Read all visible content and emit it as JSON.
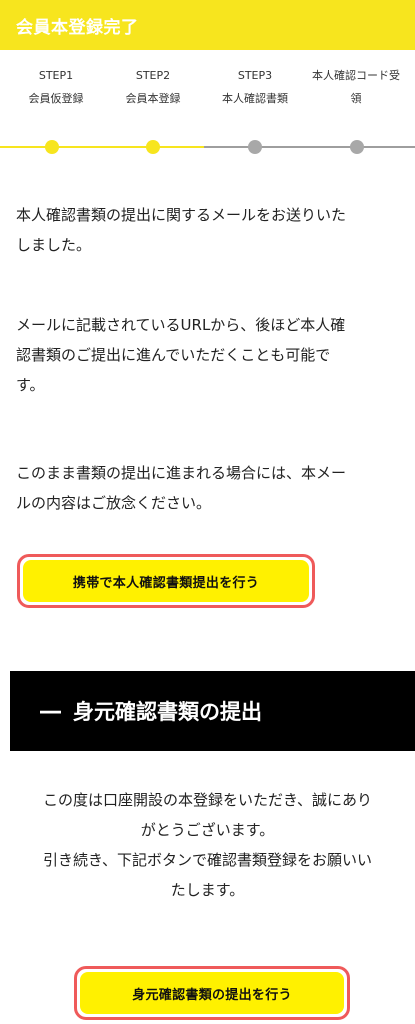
{
  "header": {
    "title": "会員本登録完了"
  },
  "steps": [
    {
      "label": "STEP1",
      "sub": "会員仮登録"
    },
    {
      "label": "STEP2",
      "sub": "会員本登録"
    },
    {
      "label": "STEP3",
      "sub": "本人確認書類"
    },
    {
      "label": "本人確認コード受",
      "sub": "領"
    }
  ],
  "progress": {
    "completed_steps": 2,
    "total_steps": 4,
    "active_color": "#f7e51e",
    "inactive_color": "#a8a8a8"
  },
  "messages": {
    "p1_line1": "本人確認書類の提出に関するメールをお送りいた",
    "p1_line2": "しました。",
    "p2_line1": "メールに記載されているURLから、後ほど本人確",
    "p2_line2": "認書類のご提出に進んでいただくことも可能で",
    "p2_line3": "す。",
    "p3_line1": "このまま書類の提出に進まれる場合には、本メー",
    "p3_line2": "ルの内容はご放念ください。"
  },
  "buttons": {
    "mobile_submit": "携帯で本人確認書類提出を行う",
    "id_submit": "身元確認書類の提出を行う"
  },
  "section": {
    "dash": "―",
    "title": "身元確認書類の提出"
  },
  "notice": {
    "line1": "この度は口座開設の本登録をいただき、誠にあり",
    "line2": "がとうございます。",
    "line3": "引き続き、下記ボタンで確認書類登録をお願いい",
    "line4": "たします。"
  },
  "colors": {
    "accent": "#f7e51e",
    "button": "#fff100",
    "button_outline": "#ef5a5a",
    "banner": "#000000"
  }
}
